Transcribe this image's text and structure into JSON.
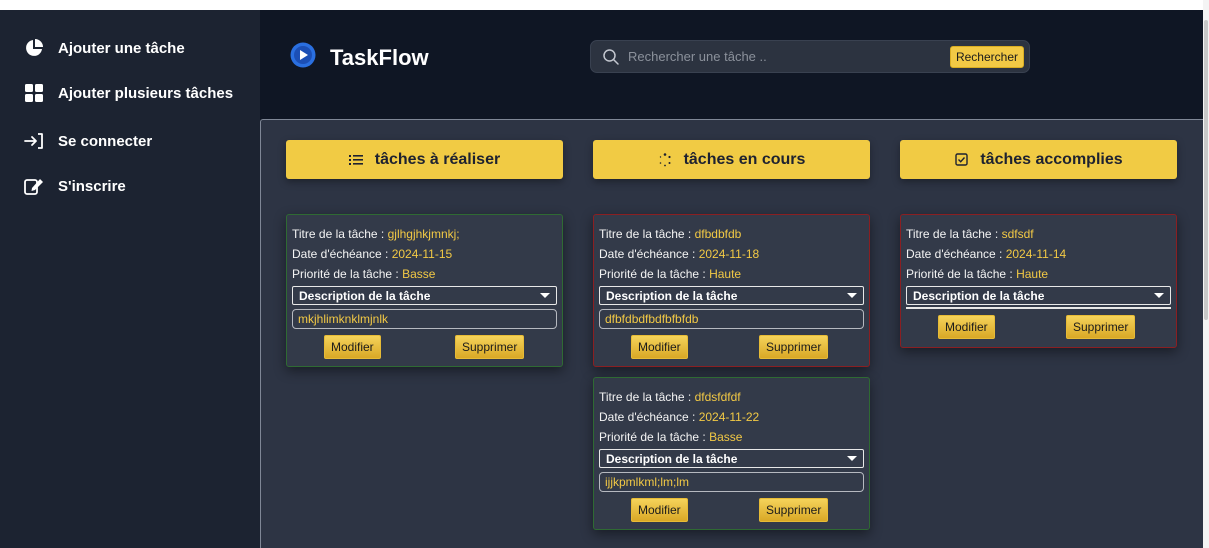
{
  "sidebar": {
    "items": [
      {
        "label": "Ajouter une tâche",
        "icon": "pie-chart-icon"
      },
      {
        "label": "Ajouter plusieurs tâches",
        "icon": "grid-icon"
      },
      {
        "label": "Se connecter",
        "icon": "login-icon"
      },
      {
        "label": "S'inscrire",
        "icon": "edit-icon"
      }
    ]
  },
  "header": {
    "app_name": "TaskFlow",
    "search_placeholder": "Rechercher une tâche ..",
    "search_button": "Rechercher"
  },
  "columns": [
    {
      "title": "tâches à réaliser",
      "icon": "list-icon"
    },
    {
      "title": "tâches en cours",
      "icon": "spinner-icon"
    },
    {
      "title": "tâches accomplies",
      "icon": "checkbox-icon"
    }
  ],
  "labels": {
    "title": "Titre de la tâche : ",
    "date": "Date d'échéance : ",
    "priority": "Priorité de la tâche : ",
    "description": "Description de la tâche",
    "edit": "Modifier",
    "delete": "Supprimer"
  },
  "tasks": [
    {
      "title": "gjlhgjhkjmnkj;",
      "date": "2024-11-15",
      "priority": "Basse",
      "description": "mkjhlimknklmjnlk"
    },
    {
      "title": "dfbdbfdb",
      "date": "2024-11-18",
      "priority": "Haute",
      "description": "dfbfdbdfbdfbfbfdb"
    },
    {
      "title": "dfdsfdfdf",
      "date": "2024-11-22",
      "priority": "Basse",
      "description": "ijjkpmlkml;lm;lm"
    },
    {
      "title": "sdfsdf",
      "date": "2024-11-14",
      "priority": "Haute",
      "description": ""
    }
  ],
  "colors": {
    "accent": "#f2c945",
    "sidebar_bg": "#1c2331",
    "header_bg": "#0f1624",
    "content_bg": "#2d3444",
    "card_bg": "#333a49",
    "low_priority_border": "#2f6a33",
    "high_priority_border": "#8a1f22"
  }
}
